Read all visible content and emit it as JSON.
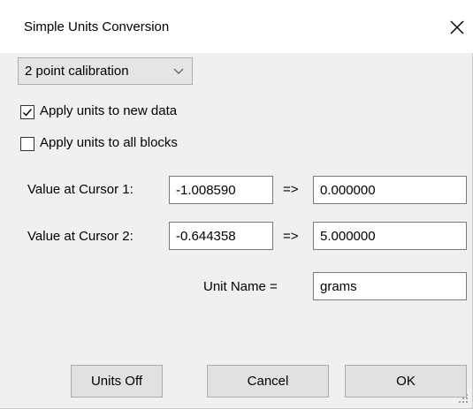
{
  "window": {
    "title": "Simple Units Conversion",
    "close_icon": "close-icon"
  },
  "mode": {
    "selected": "2 point calibration",
    "icon": "chevron-down-icon"
  },
  "options": {
    "apply_new_data": {
      "label": "Apply units to new data",
      "checked": true
    },
    "apply_all_blocks": {
      "label": "Apply units to all blocks",
      "checked": false
    }
  },
  "cursor1": {
    "label": "Value at Cursor 1:",
    "value": "-1.008590",
    "arrow": "=>",
    "converted": "0.000000"
  },
  "cursor2": {
    "label": "Value at Cursor 2:",
    "value": "-0.644358",
    "arrow": "=>",
    "converted": "5.000000"
  },
  "unit": {
    "label": "Unit Name =",
    "value": "grams"
  },
  "buttons": {
    "units_off": "Units Off",
    "cancel": "Cancel",
    "ok": "OK"
  },
  "colors": {
    "title_bg": "#ffffff",
    "client_bg": "#f0f0f0",
    "button_bg": "#e1e1e1",
    "field_border": "#7a7a7a"
  }
}
